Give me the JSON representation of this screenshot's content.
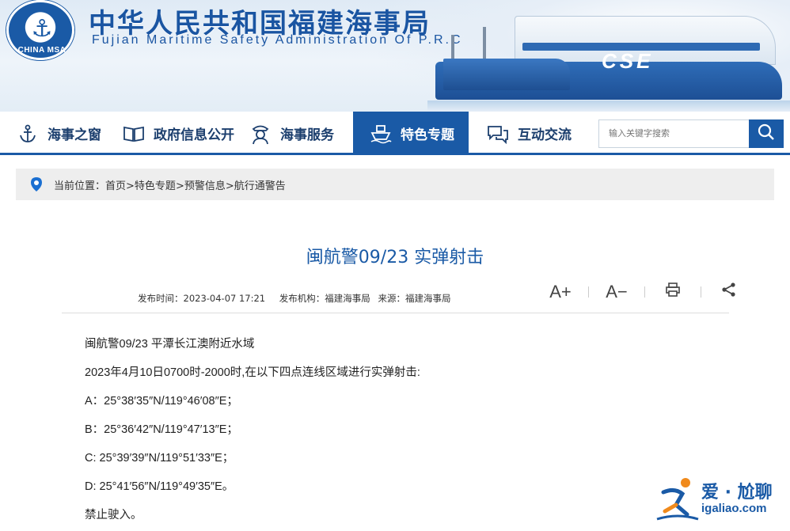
{
  "header": {
    "title_cn": "中华人民共和国福建海事局",
    "title_en": "Fujian Maritime Safety Administration Of P.R.C",
    "logo_text": "CHINA MSA",
    "ship_label": "CSE"
  },
  "nav": {
    "items": [
      {
        "label": "海事之窗",
        "icon": "anchor-icon"
      },
      {
        "label": "政府信息公开",
        "icon": "book-icon"
      },
      {
        "label": "海事服务",
        "icon": "officer-icon"
      },
      {
        "label": "特色专题",
        "icon": "ship-icon",
        "active": true
      },
      {
        "label": "互动交流",
        "icon": "chat-icon"
      }
    ],
    "search_placeholder": "输入关键字搜索"
  },
  "breadcrumb": {
    "prefix": "当前位置：",
    "items": [
      "首页",
      ">特色专题",
      ">预警信息",
      ">航行通警告"
    ]
  },
  "article": {
    "title": "闽航警09/23 实弹射击",
    "publish_time": "发布时间：2023-04-07 17:21",
    "publisher": "发布机构：福建海事局",
    "source": "来源：福建海事局",
    "tools": {
      "font_up": "A+",
      "font_down": "A−"
    },
    "paragraphs": [
      "闽航警09/23  平潭长江澳附近水域",
      "2023年4月10日0700时-2000时,在以下四点连线区域进行实弹射击:",
      "A：25°38′35″N/119°46′08″E；",
      "B：25°36′42″N/119°47′13″E；",
      "C: 25°39′39″N/119°51′33″E；",
      "D: 25°41′56″N/119°49′35″E。",
      "禁止驶入。"
    ]
  },
  "watermark": {
    "title": "爱 · 尬聊",
    "url": "igaliao.com"
  },
  "colors": {
    "brand_blue": "#1a5aa6",
    "breadcrumb_bg": "#eeeeee"
  }
}
